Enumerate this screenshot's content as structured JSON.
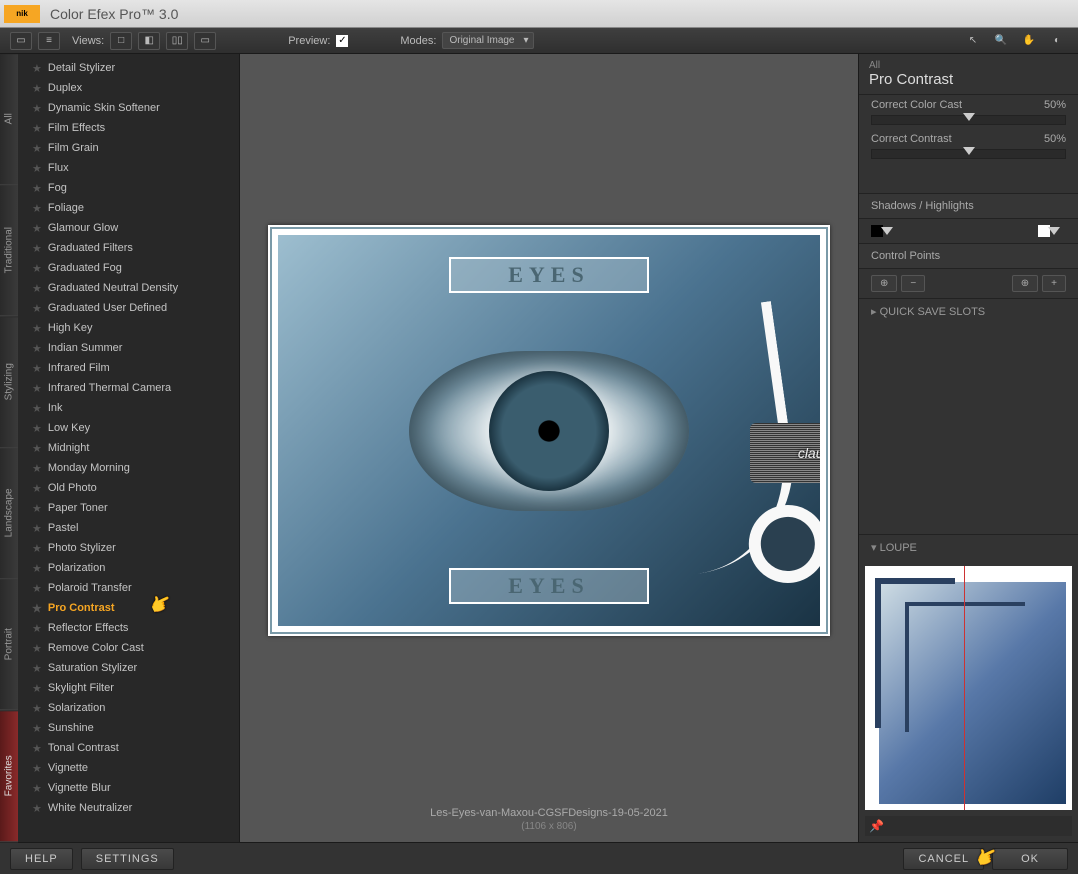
{
  "app": {
    "title": "Color Efex Pro™ 3.0",
    "logo": "nik"
  },
  "toolbar": {
    "viewsLabel": "Views:",
    "previewLabel": "Preview:",
    "previewChecked": true,
    "modesLabel": "Modes:",
    "modeSelected": "Original Image"
  },
  "categories": [
    "All",
    "Traditional",
    "Stylizing",
    "Landscape",
    "Portrait",
    "Favorites"
  ],
  "filters": [
    {
      "label": "Detail Stylizer",
      "active": false
    },
    {
      "label": "Duplex",
      "active": false
    },
    {
      "label": "Dynamic Skin Softener",
      "active": false
    },
    {
      "label": "Film Effects",
      "active": false
    },
    {
      "label": "Film Grain",
      "active": false
    },
    {
      "label": "Flux",
      "active": false
    },
    {
      "label": "Fog",
      "active": false
    },
    {
      "label": "Foliage",
      "active": false
    },
    {
      "label": "Glamour Glow",
      "active": false
    },
    {
      "label": "Graduated Filters",
      "active": false
    },
    {
      "label": "Graduated Fog",
      "active": false
    },
    {
      "label": "Graduated Neutral Density",
      "active": false
    },
    {
      "label": "Graduated User Defined",
      "active": false
    },
    {
      "label": "High Key",
      "active": false
    },
    {
      "label": "Indian Summer",
      "active": false
    },
    {
      "label": "Infrared Film",
      "active": false
    },
    {
      "label": "Infrared Thermal Camera",
      "active": false
    },
    {
      "label": "Ink",
      "active": false
    },
    {
      "label": "Low Key",
      "active": false
    },
    {
      "label": "Midnight",
      "active": false
    },
    {
      "label": "Monday Morning",
      "active": false
    },
    {
      "label": "Old Photo",
      "active": false
    },
    {
      "label": "Paper Toner",
      "active": false
    },
    {
      "label": "Pastel",
      "active": false
    },
    {
      "label": "Photo Stylizer",
      "active": false
    },
    {
      "label": "Polarization",
      "active": false
    },
    {
      "label": "Polaroid Transfer",
      "active": false
    },
    {
      "label": "Pro Contrast",
      "active": true
    },
    {
      "label": "Reflector Effects",
      "active": false
    },
    {
      "label": "Remove Color Cast",
      "active": false
    },
    {
      "label": "Saturation Stylizer",
      "active": false
    },
    {
      "label": "Skylight Filter",
      "active": false
    },
    {
      "label": "Solarization",
      "active": false
    },
    {
      "label": "Sunshine",
      "active": false
    },
    {
      "label": "Tonal Contrast",
      "active": false
    },
    {
      "label": "Vignette",
      "active": false
    },
    {
      "label": "Vignette Blur",
      "active": false
    },
    {
      "label": "White Neutralizer",
      "active": false
    }
  ],
  "image": {
    "filename": "Les-Eyes-van-Maxou-CGSFDesigns-19-05-2021",
    "dimensions": "(1106 x 806)",
    "overlayTop": "EYES",
    "overlayBottom": "EYES",
    "watermark": "claudia"
  },
  "panel": {
    "category": "All",
    "title": "Pro Contrast",
    "sliders": [
      {
        "label": "Correct Color Cast",
        "value": "50%"
      },
      {
        "label": "Correct Contrast",
        "value": "50%"
      }
    ],
    "shadowsHighlights": "Shadows / Highlights",
    "controlPoints": "Control Points",
    "quickSave": "QUICK SAVE SLOTS",
    "loupe": "LOUPE"
  },
  "footer": {
    "help": "HELP",
    "settings": "SETTINGS",
    "cancel": "CANCEL",
    "ok": "OK"
  }
}
